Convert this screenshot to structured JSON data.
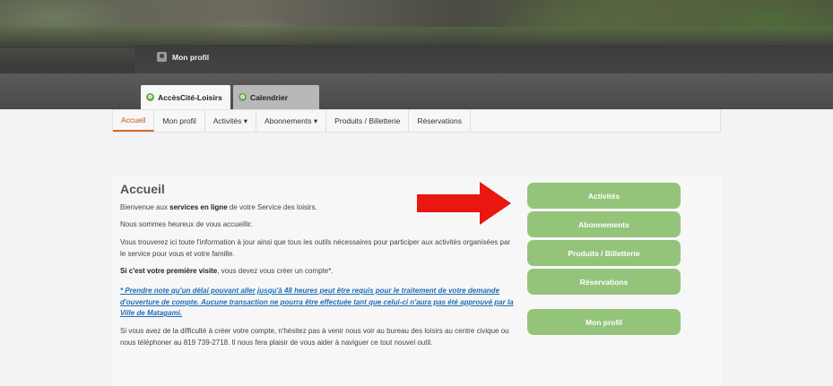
{
  "header": {
    "profile_link": "Mon profil",
    "tabs": [
      {
        "label": "AccèsCité-Loisirs",
        "icon": "leaf-icon"
      },
      {
        "label": "Calendrier",
        "icon": "leaf-icon"
      }
    ]
  },
  "nav": {
    "items": [
      "Accueil",
      "Mon profil",
      "Activités ▾",
      "Abonnements ▾",
      "Produits / Billetterie",
      "Réservations"
    ]
  },
  "main": {
    "title": "Accueil",
    "p1_pre": "Bienvenue aux ",
    "p1_bold": "services en ligne",
    "p1_post": " de votre Service des loisirs.",
    "p2": "Nous sommes heureux de vous accueillir.",
    "p3": "Vous trouverez ici toute l'information à jour ainsi que tous les outils nécessaires pour participer aux activités organisées par le service pour vous et votre famille.",
    "p4_bold": "Si c'est votre première visite",
    "p4_post": ", vous devez vous créer un compte*.",
    "note": "* Prendre note qu'un délai pouvant aller jusqu'à 48 heures peut être requis pour le traitement de votre demande d'ouverture de compte. Aucune transaction ne pourra être effectuée tant que celui-ci n'aura pas été approuvé par la Ville de Matagami.",
    "p5": "Si vous avez de la difficulté à créer votre compte, n'hésitez pas à venir nous voir au bureau des loisirs au centre civique ou nous téléphoner au 819 739-2718. Il nous fera plaisir de vous aider à naviguer ce tout nouvel outil."
  },
  "sidebar": {
    "buttons": [
      "Activités",
      "Abonnements",
      "Produits / Billetterie",
      "Réservations",
      "Mon profil"
    ]
  },
  "colors": {
    "accent_green": "#94c47a",
    "arrow_red": "#e8170f",
    "nav_active": "#c8501e",
    "link_blue": "#1f6fb5"
  }
}
